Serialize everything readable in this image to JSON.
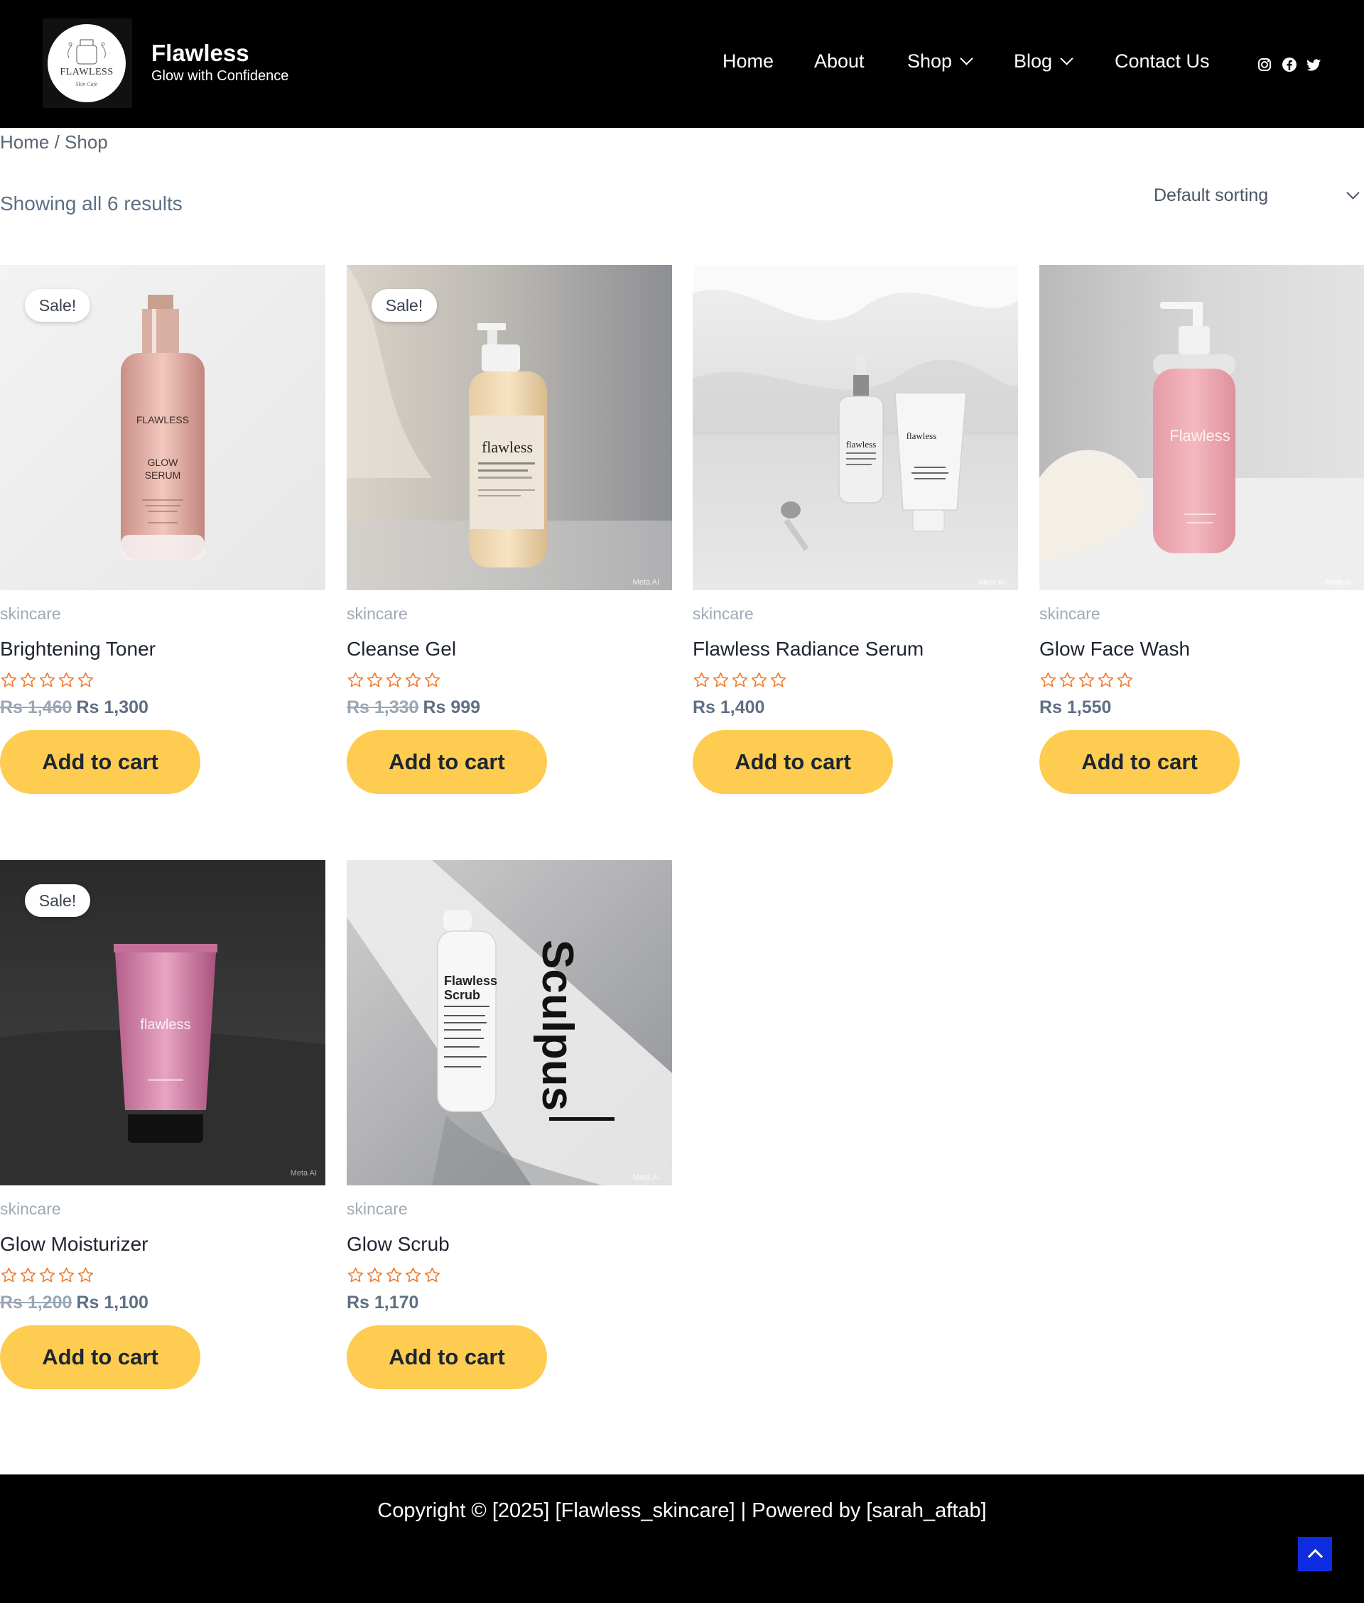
{
  "site": {
    "logo_text": "FLAWLESS",
    "logo_subtext": "Skin Cafe",
    "title": "Flawless",
    "tagline": "Glow with Confidence"
  },
  "nav": {
    "items": [
      {
        "label": "Home"
      },
      {
        "label": "About"
      },
      {
        "label": "Shop"
      },
      {
        "label": "Blog"
      },
      {
        "label": "Contact Us"
      }
    ],
    "social_icons": [
      "instagram-icon",
      "facebook-icon",
      "twitter-icon"
    ]
  },
  "breadcrumb": {
    "home": "Home",
    "separator": " / ",
    "current": "Shop"
  },
  "toolbar": {
    "result_count": "Showing all 6 results",
    "sorting": "Default sorting"
  },
  "colors": {
    "header_bg": "#000000",
    "button": "#fecc50",
    "price": "#5f6f84",
    "scroll_top": "#0f2de0"
  },
  "products": [
    {
      "category": "skincare",
      "name": "Brightening Toner",
      "sale_badge": "Sale!",
      "old_price": "Rs 1,460",
      "price": "Rs 1,300",
      "rating_stars": 0,
      "button": "Add to cart",
      "image_text": [
        "FLAWLESS",
        "GLOW",
        "SERUM"
      ]
    },
    {
      "category": "skincare",
      "name": "Cleanse Gel",
      "sale_badge": "Sale!",
      "old_price": "Rs 1,330",
      "price": "Rs 999",
      "rating_stars": 0,
      "button": "Add to cart",
      "image_text": [
        "flawless"
      ],
      "watermark": "Meta AI"
    },
    {
      "category": "skincare",
      "name": "Flawless Radiance Serum",
      "sale_badge": "",
      "old_price": "",
      "price": "Rs 1,400",
      "rating_stars": 0,
      "button": "Add to cart",
      "image_text": [
        "flawless",
        "flawless"
      ],
      "watermark": "Meta AI"
    },
    {
      "category": "skincare",
      "name": "Glow Face Wash",
      "sale_badge": "",
      "old_price": "",
      "price": "Rs 1,550",
      "rating_stars": 0,
      "button": "Add to cart",
      "image_text": [
        "Flawless"
      ],
      "watermark": "Meta AI"
    },
    {
      "category": "skincare",
      "name": "Glow Moisturizer",
      "sale_badge": "Sale!",
      "old_price": "Rs 1,200",
      "price": "Rs 1,100",
      "rating_stars": 0,
      "button": "Add to cart",
      "image_text": [
        "flawless"
      ],
      "watermark": "Meta AI"
    },
    {
      "category": "skincare",
      "name": "Glow Scrub",
      "sale_badge": "",
      "old_price": "",
      "price": "Rs 1,170",
      "rating_stars": 0,
      "button": "Add to cart",
      "image_text": [
        "Flawless",
        "Scrub",
        "Sculpus"
      ],
      "watermark": "Meta AI"
    }
  ],
  "footer": {
    "copyright": "Copyright © [2025] [Flawless_skincare] | Powered by [sarah_aftab]"
  }
}
